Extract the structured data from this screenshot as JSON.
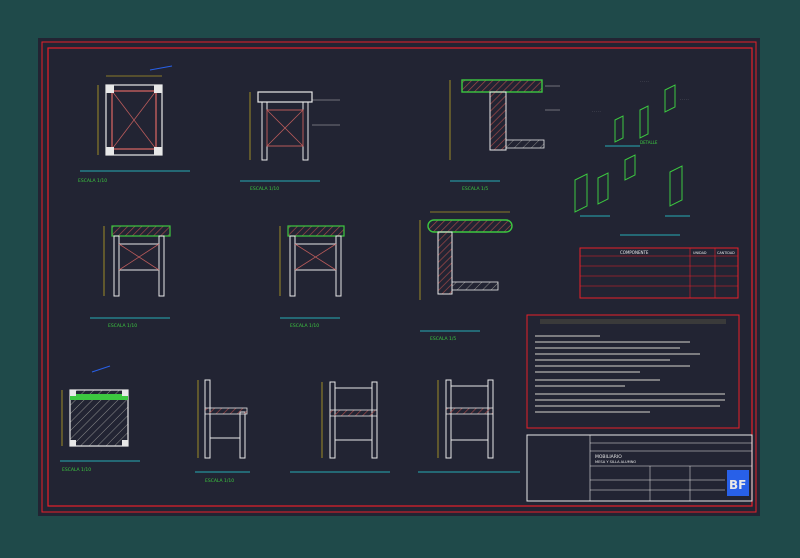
{
  "colors": {
    "page": "#1f4a4a",
    "paper": "#222433",
    "frame": "#e8202a",
    "line": "#e8e8e8",
    "dim": "#f0d020",
    "caption": "#2ad8e0",
    "accent_green": "#3cc840",
    "accent_wood": "#b85a5a",
    "blue": "#2860e8"
  },
  "views": {
    "table_plan_scale": "ESCALA 1/10",
    "table_front_scale": "ESCALA 1/10",
    "table_detail_scale": "ESCALA 1/5",
    "table_elev_a_scale": "ESCALA 1/10",
    "table_elev_b_scale": "ESCALA 1/10",
    "table_detail_b_scale": "ESCALA 1/5",
    "chair_plan_scale": "ESCALA 1/10",
    "chair_side_scale": "ESCALA 1/10",
    "iso_detail_label": "DETALLE"
  },
  "materials_table": {
    "header_item": "COMPONENTE",
    "header_unit": "UNIDAD",
    "header_qty": "CANTIDAD"
  },
  "title_block": {
    "project": "MOBILIARIO",
    "subtitle": "MESA Y SILLA ALUMNO",
    "logo": "BF"
  }
}
